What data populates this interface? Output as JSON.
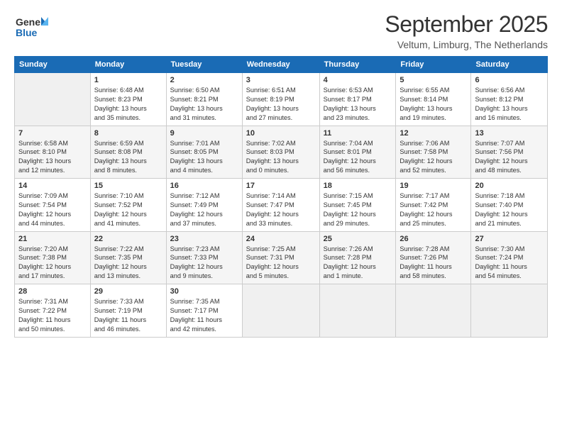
{
  "header": {
    "logo_general": "General",
    "logo_blue": "Blue",
    "month_title": "September 2025",
    "location": "Veltum, Limburg, The Netherlands"
  },
  "days_of_week": [
    "Sunday",
    "Monday",
    "Tuesday",
    "Wednesday",
    "Thursday",
    "Friday",
    "Saturday"
  ],
  "weeks": [
    [
      {
        "day": "",
        "empty": true
      },
      {
        "day": "1",
        "sunrise": "6:48 AM",
        "sunset": "8:23 PM",
        "daylight": "13 hours and 35 minutes."
      },
      {
        "day": "2",
        "sunrise": "6:50 AM",
        "sunset": "8:21 PM",
        "daylight": "13 hours and 31 minutes."
      },
      {
        "day": "3",
        "sunrise": "6:51 AM",
        "sunset": "8:19 PM",
        "daylight": "13 hours and 27 minutes."
      },
      {
        "day": "4",
        "sunrise": "6:53 AM",
        "sunset": "8:17 PM",
        "daylight": "13 hours and 23 minutes."
      },
      {
        "day": "5",
        "sunrise": "6:55 AM",
        "sunset": "8:14 PM",
        "daylight": "13 hours and 19 minutes."
      },
      {
        "day": "6",
        "sunrise": "6:56 AM",
        "sunset": "8:12 PM",
        "daylight": "13 hours and 16 minutes."
      }
    ],
    [
      {
        "day": "7",
        "sunrise": "6:58 AM",
        "sunset": "8:10 PM",
        "daylight": "13 hours and 12 minutes."
      },
      {
        "day": "8",
        "sunrise": "6:59 AM",
        "sunset": "8:08 PM",
        "daylight": "13 hours and 8 minutes."
      },
      {
        "day": "9",
        "sunrise": "7:01 AM",
        "sunset": "8:05 PM",
        "daylight": "13 hours and 4 minutes."
      },
      {
        "day": "10",
        "sunrise": "7:02 AM",
        "sunset": "8:03 PM",
        "daylight": "13 hours and 0 minutes."
      },
      {
        "day": "11",
        "sunrise": "7:04 AM",
        "sunset": "8:01 PM",
        "daylight": "12 hours and 56 minutes."
      },
      {
        "day": "12",
        "sunrise": "7:06 AM",
        "sunset": "7:58 PM",
        "daylight": "12 hours and 52 minutes."
      },
      {
        "day": "13",
        "sunrise": "7:07 AM",
        "sunset": "7:56 PM",
        "daylight": "12 hours and 48 minutes."
      }
    ],
    [
      {
        "day": "14",
        "sunrise": "7:09 AM",
        "sunset": "7:54 PM",
        "daylight": "12 hours and 44 minutes."
      },
      {
        "day": "15",
        "sunrise": "7:10 AM",
        "sunset": "7:52 PM",
        "daylight": "12 hours and 41 minutes."
      },
      {
        "day": "16",
        "sunrise": "7:12 AM",
        "sunset": "7:49 PM",
        "daylight": "12 hours and 37 minutes."
      },
      {
        "day": "17",
        "sunrise": "7:14 AM",
        "sunset": "7:47 PM",
        "daylight": "12 hours and 33 minutes."
      },
      {
        "day": "18",
        "sunrise": "7:15 AM",
        "sunset": "7:45 PM",
        "daylight": "12 hours and 29 minutes."
      },
      {
        "day": "19",
        "sunrise": "7:17 AM",
        "sunset": "7:42 PM",
        "daylight": "12 hours and 25 minutes."
      },
      {
        "day": "20",
        "sunrise": "7:18 AM",
        "sunset": "7:40 PM",
        "daylight": "12 hours and 21 minutes."
      }
    ],
    [
      {
        "day": "21",
        "sunrise": "7:20 AM",
        "sunset": "7:38 PM",
        "daylight": "12 hours and 17 minutes."
      },
      {
        "day": "22",
        "sunrise": "7:22 AM",
        "sunset": "7:35 PM",
        "daylight": "12 hours and 13 minutes."
      },
      {
        "day": "23",
        "sunrise": "7:23 AM",
        "sunset": "7:33 PM",
        "daylight": "12 hours and 9 minutes."
      },
      {
        "day": "24",
        "sunrise": "7:25 AM",
        "sunset": "7:31 PM",
        "daylight": "12 hours and 5 minutes."
      },
      {
        "day": "25",
        "sunrise": "7:26 AM",
        "sunset": "7:28 PM",
        "daylight": "12 hours and 1 minute."
      },
      {
        "day": "26",
        "sunrise": "7:28 AM",
        "sunset": "7:26 PM",
        "daylight": "11 hours and 58 minutes."
      },
      {
        "day": "27",
        "sunrise": "7:30 AM",
        "sunset": "7:24 PM",
        "daylight": "11 hours and 54 minutes."
      }
    ],
    [
      {
        "day": "28",
        "sunrise": "7:31 AM",
        "sunset": "7:22 PM",
        "daylight": "11 hours and 50 minutes."
      },
      {
        "day": "29",
        "sunrise": "7:33 AM",
        "sunset": "7:19 PM",
        "daylight": "11 hours and 46 minutes."
      },
      {
        "day": "30",
        "sunrise": "7:35 AM",
        "sunset": "7:17 PM",
        "daylight": "11 hours and 42 minutes."
      },
      {
        "day": "",
        "empty": true
      },
      {
        "day": "",
        "empty": true
      },
      {
        "day": "",
        "empty": true
      },
      {
        "day": "",
        "empty": true
      }
    ]
  ]
}
